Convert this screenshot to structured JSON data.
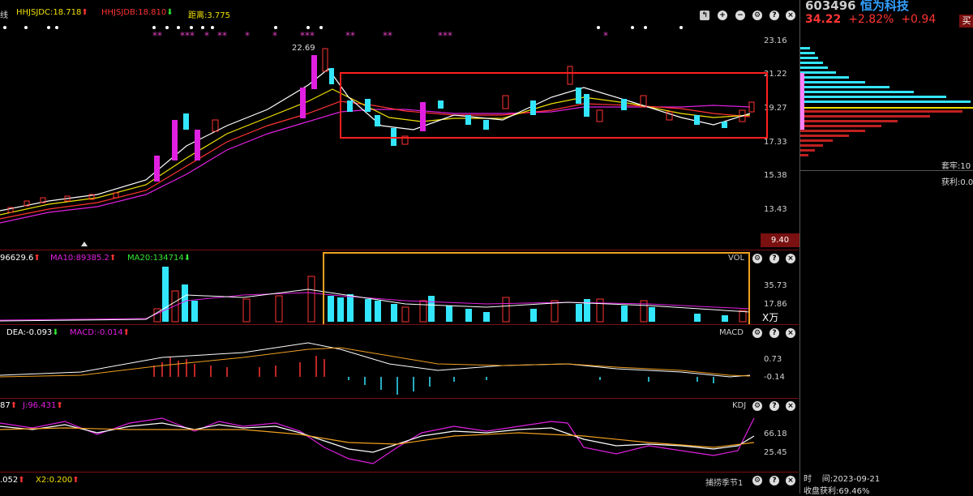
{
  "toolbar_top": {
    "hhjsjdc": "HHJSJDC:18.718",
    "hhjsjdb": "HHJSJDB:18.810",
    "distance": "距离:3.775",
    "period_label": "线"
  },
  "main_chart": {
    "price_axis": [
      "23.16",
      "21.22",
      "19.27",
      "17.33",
      "15.38",
      "13.43"
    ],
    "high_label": "22.69",
    "current_price_tag": "9.40"
  },
  "vol_panel": {
    "ma5": "96629.6",
    "ma10": "MA10:89385.2",
    "ma20": "MA20:134714",
    "name": "VOL",
    "axis": [
      "35.73",
      "17.86"
    ],
    "unit": "X万"
  },
  "macd_panel": {
    "dea": "DEA:-0.093",
    "macd": "MACD:-0.014",
    "name": "MACD",
    "axis": [
      "0.73",
      "-0.14"
    ]
  },
  "kdj_panel": {
    "k": "87",
    "j": "J:96.431",
    "name": "KDJ",
    "axis": [
      "66.18",
      "25.45"
    ]
  },
  "bottom_panel": {
    "x1": ".052",
    "x2": "X2:0.200",
    "name": "捕捞季节1"
  },
  "stock": {
    "code": "603496",
    "name": "恒为科技",
    "price": "34.22",
    "change_pct": "+2.82%",
    "change": "+0.94",
    "buy_label": "买",
    "label_chuang": "套牢:10",
    "label_huoli": "获利:0.0",
    "time_label": "时",
    "time_value": "间:2023-09-21",
    "profit_label": "收盘获利:69.46%"
  },
  "colors": {
    "up": "#ff3333",
    "down": "#33e6ff",
    "magenta": "#e020e0",
    "yellow": "#f0e000",
    "frame_red": "#ff2020",
    "frame_orange": "#f0a020"
  }
}
